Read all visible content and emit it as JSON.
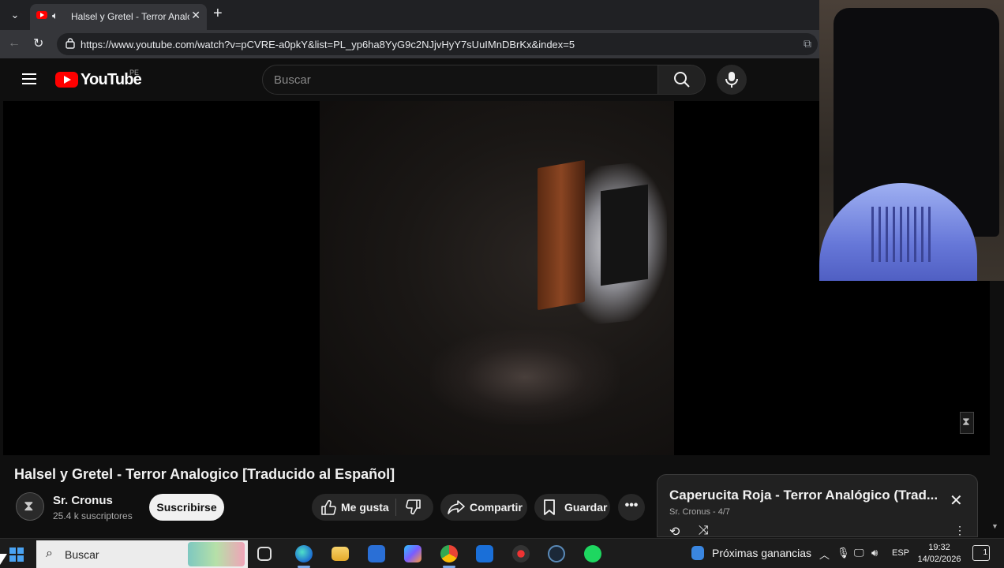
{
  "browser": {
    "tab_title": "Halsel y Gretel - Terror Analog",
    "url": "https://www.youtube.com/watch?v=pCVRE-a0pkY&list=PL_yp6ha8YyG9c2NJjvHyY7sUuIMnDBrKx&index=5"
  },
  "youtube": {
    "logo_text": "YouTube",
    "country_code": "PE",
    "search_placeholder": "Buscar"
  },
  "video": {
    "title": "Halsel y Gretel - Terror Analogico [Traducido al Español]",
    "channel_name": "Sr. Cronus",
    "subscribers": "25.4 k suscriptores",
    "subscribe_label": "Suscribirse",
    "like_label": "Me gusta",
    "share_label": "Compartir",
    "save_label": "Guardar",
    "more_label": "•••"
  },
  "playlist": {
    "now_title": "Caperucita Roja - Terror Analógico (Trad...",
    "subtitle": "Sr. Cronus - 4/7"
  },
  "taskbar": {
    "search_label": "Buscar",
    "widget_label": "Próximas ganancias",
    "language": "ESP",
    "time": "19:32",
    "date": "14/02/2026",
    "notification_count": "1"
  },
  "icons": [
    "tab-list-icon",
    "speaker-icon",
    "close-tab-icon",
    "new-tab-icon",
    "back-icon",
    "reload-icon",
    "site-info-icon",
    "menu-icon",
    "search-icon",
    "mic-icon",
    "like-icon",
    "dislike-icon",
    "share-icon",
    "save-icon",
    "loop-icon",
    "shuffle-icon",
    "close-icon",
    "windows-start-icon"
  ],
  "colors": {
    "youtube_red": "#ff0000",
    "background": "#0f0f0f",
    "chrome_tab": "#35363a"
  }
}
